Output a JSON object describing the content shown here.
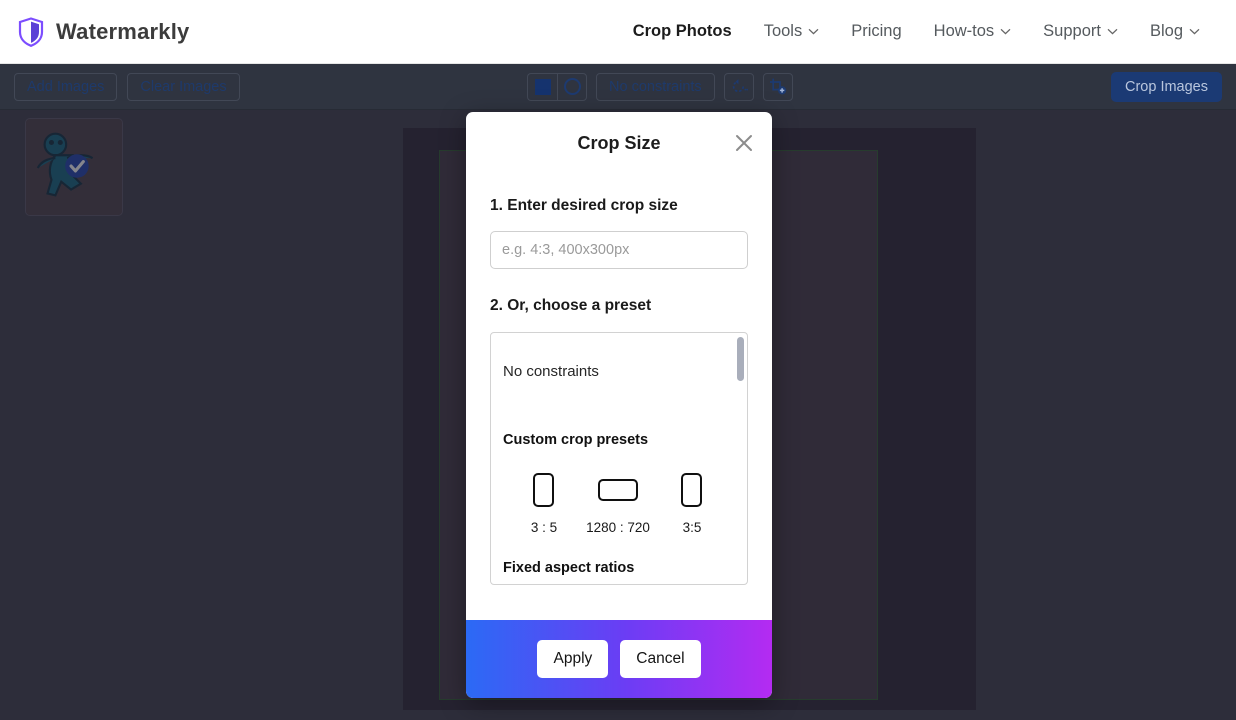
{
  "header": {
    "logo_icon": "shield-icon",
    "brand": "Watermarkly",
    "nav": [
      {
        "label": "Crop Photos",
        "active": true,
        "caret": false
      },
      {
        "label": "Tools",
        "active": false,
        "caret": true
      },
      {
        "label": "Pricing",
        "active": false,
        "caret": false
      },
      {
        "label": "How-tos",
        "active": false,
        "caret": true
      },
      {
        "label": "Support",
        "active": false,
        "caret": true
      },
      {
        "label": "Blog",
        "active": false,
        "caret": true
      }
    ]
  },
  "toolbar": {
    "add_images": "Add Images",
    "clear_images": "Clear Images",
    "shape_square_icon": "square-shape-icon",
    "shape_circle_icon": "circle-shape-icon",
    "constraints_label": "No constraints",
    "rotate_icon": "rotate-reset-icon",
    "add_crop_icon": "add-crop-area-icon",
    "crop_images": "Crop Images"
  },
  "workspace": {
    "thumbnail_name": "image-thumbnail",
    "canvas_name": "crop-canvas",
    "crop_frame_name": "crop-selection-frame"
  },
  "modal": {
    "title": "Crop Size",
    "close_icon": "close-icon",
    "step1_label": "1. Enter desired crop size",
    "size_input_value": "",
    "size_input_placeholder": "e.g. 4:3, 400x300px",
    "step2_label": "2. Or, choose a preset",
    "preset_none": "No constraints",
    "custom_presets_title": "Custom crop presets",
    "presets": [
      {
        "caption": "3 : 5",
        "orientation": "portrait"
      },
      {
        "caption": "1280 : 720",
        "orientation": "landscape"
      },
      {
        "caption": "3:5",
        "orientation": "portrait"
      }
    ],
    "fixed_ratios_title": "Fixed aspect ratios",
    "apply": "Apply",
    "cancel": "Cancel",
    "footer_gradient_from": "#2b6af5",
    "footer_gradient_to": "#b42bf2"
  }
}
